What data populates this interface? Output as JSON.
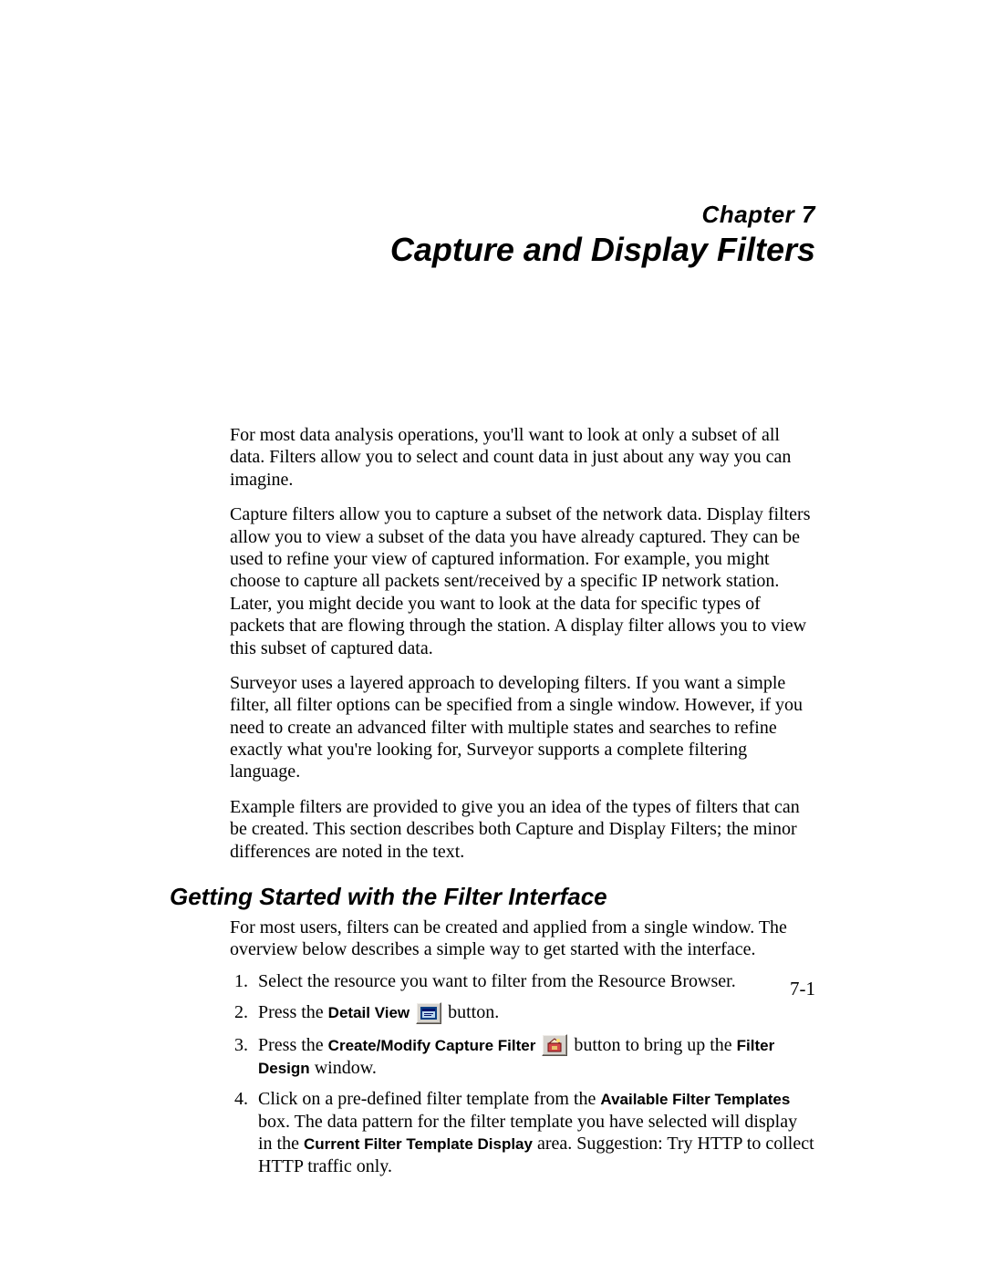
{
  "chapter": {
    "label_prefix": "Chapter",
    "number": "7",
    "title": "Capture and Display Filters"
  },
  "intro": {
    "p1": "For most data analysis operations, you'll want to look at only a subset of all data. Filters allow you to select and count data in just about any way you can imagine.",
    "p2": "Capture filters allow you to capture a subset of the network data. Display filters allow you to view a subset of the data you have already captured. They can be used to refine your view of captured information. For example, you might choose to cap­ture all packets sent/received by a specific IP network station. Later, you might decide you want to look at the data for specific types of packets that are flowing through the station. A display filter allows you to view this subset of captured data.",
    "p3": "Surveyor uses a layered approach to developing filters. If you want a simple filter, all filter options can be specified from a single window. However, if you need to create an advanced filter with multiple states and searches to refine exactly what you're looking for, Surveyor supports a complete filtering language.",
    "p4": "Example filters are provided to give you an idea of the types of filters that can be created. This section describes both Capture and Display Filters; the minor differ­ences are noted in the text."
  },
  "section": {
    "heading": "Getting Started with the Filter Interface",
    "lead": "For most users, filters can be created and applied from a single window. The over­view below describes a simple way to get started with the interface.",
    "steps": {
      "s1": "Select the resource you want to filter from the Resource Browser.",
      "s2_a": "Press the ",
      "s2_bold": "Detail View",
      "s2_b": " button.",
      "s3_a": "Press the ",
      "s3_bold1": "Create/Modify Capture Filter",
      "s3_b": " button to bring up the ",
      "s3_bold2": "Filter Design",
      "s3_c": " window.",
      "s4_a": "Click on a pre-defined filter template from the ",
      "s4_bold1": "Available Filter Templates",
      "s4_b": " box. The data pattern for the filter template you have selected will display in the ",
      "s4_bold2": "Current Filter Template Display",
      "s4_c": " area. Suggestion: Try HTTP to collect HTTP traffic only."
    }
  },
  "icons": {
    "detail_view": "detail-view-icon",
    "create_filter": "create-filter-icon"
  },
  "page_number": "7-1"
}
